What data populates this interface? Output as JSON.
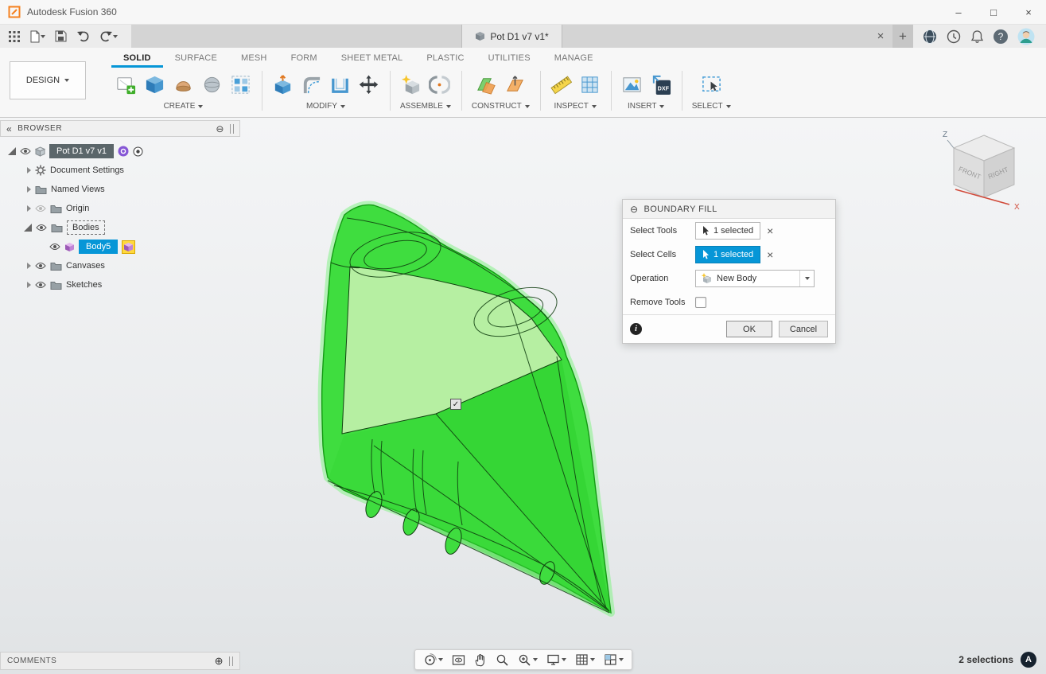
{
  "window": {
    "title": "Autodesk Fusion 360",
    "min": "–",
    "max": "□",
    "close": "×"
  },
  "icons": {
    "collapse_left": "«",
    "minus_circle": "⊖",
    "plus_circle": "⊕",
    "close": "×",
    "plus_tab": "+",
    "help": "?",
    "info": "i",
    "assistant": "A",
    "check": "✓",
    "dxf": "DXF"
  },
  "tab": {
    "title": "Pot D1 v7 v1*"
  },
  "ribbon": {
    "design_label": "DESIGN",
    "tabs": [
      {
        "label": "SOLID",
        "active": true
      },
      {
        "label": "SURFACE"
      },
      {
        "label": "MESH"
      },
      {
        "label": "FORM"
      },
      {
        "label": "SHEET METAL"
      },
      {
        "label": "PLASTIC"
      },
      {
        "label": "UTILITIES"
      },
      {
        "label": "MANAGE"
      }
    ],
    "groups": [
      {
        "label": "CREATE"
      },
      {
        "label": "MODIFY"
      },
      {
        "label": "ASSEMBLE"
      },
      {
        "label": "CONSTRUCT"
      },
      {
        "label": "INSPECT"
      },
      {
        "label": "INSERT"
      },
      {
        "label": "SELECT"
      }
    ]
  },
  "browser": {
    "title": "BROWSER",
    "items": [
      {
        "label": "Pot D1 v7 v1"
      },
      {
        "label": "Document Settings"
      },
      {
        "label": "Named Views"
      },
      {
        "label": "Origin"
      },
      {
        "label": "Bodies"
      },
      {
        "label": "Body5"
      },
      {
        "label": "Canvases"
      },
      {
        "label": "Sketches"
      }
    ]
  },
  "dialog": {
    "title": "BOUNDARY FILL",
    "select_tools_label": "Select Tools",
    "select_tools_value": "1 selected",
    "select_cells_label": "Select Cells",
    "select_cells_value": "1 selected",
    "operation_label": "Operation",
    "operation_value": "New Body",
    "remove_tools_label": "Remove Tools",
    "ok": "OK",
    "cancel": "Cancel"
  },
  "viewcube": {
    "front": "FRONT",
    "right": "RIGHT",
    "z": "Z",
    "x": "X"
  },
  "comments": {
    "label": "COMMENTS"
  },
  "status": {
    "selections": "2 selections"
  },
  "colors": {
    "accent": "#0696d7",
    "body_green": "#3fdd3f",
    "body_green_light": "#bdf0a8",
    "root_chip": "#5b666a"
  }
}
